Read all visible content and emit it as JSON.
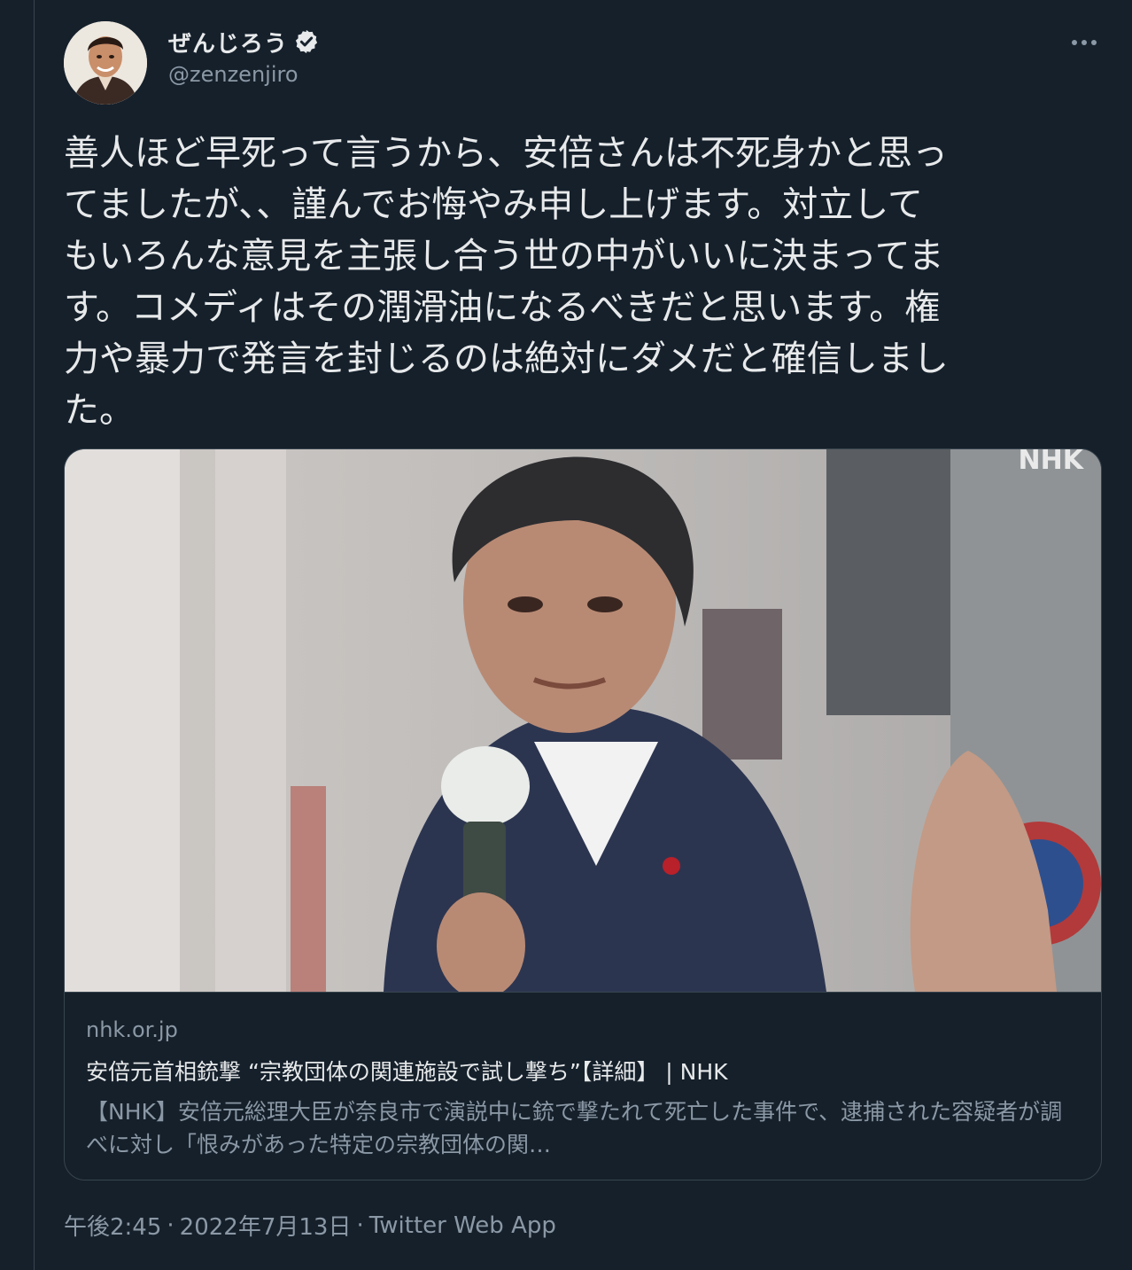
{
  "colors": {
    "background": "#15202b",
    "primary_text": "#e7e9ea",
    "secondary_text": "#8b98a5",
    "border": "#38444d"
  },
  "author": {
    "display_name": "ぜんじろう",
    "handle": "@zenzenjiro",
    "verified_icon": "verified-badge-icon",
    "avatar": "profile photo"
  },
  "tweet": {
    "text": "善人ほど早死って言うから、安倍さんは不死身かと思っ\nてましたが、、謹んでお悔やみ申し上げます。対立して\nもいろんな意見を主張し合う世の中がいいに決まってま\nす。コメディはその潤滑油になるべきだと思います。権\n力や暴力で発言を封じるのは絶対にダメだと確信しまし\nた。"
  },
  "card": {
    "image_watermark": "NHK",
    "domain": "nhk.or.jp",
    "title": "安倍元首相銃撃 “宗教団体の関連施設で試し撃ち”【詳細】 | NHK",
    "description": "【NHK】安倍元総理大臣が奈良市で演説中に銃で撃たれて死亡した事件で、逮捕された容疑者が調べに対し「恨みがあった特定の宗教団体の関…"
  },
  "meta": {
    "time": "午後2:45",
    "separator": "·",
    "date": "2022年7月13日",
    "source": "Twitter Web App"
  }
}
